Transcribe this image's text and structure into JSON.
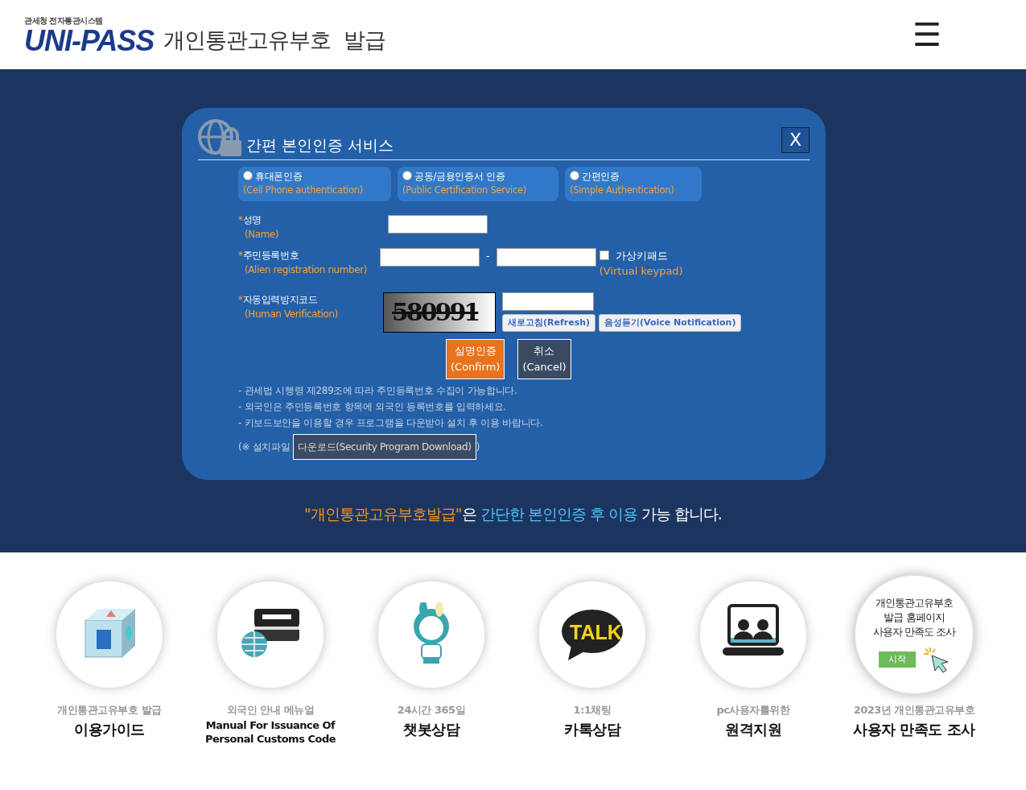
{
  "header": {
    "logo_caption": "관세청 전자통관시스템",
    "logo_text": "UNI-PASS",
    "title": "개인통관고유부호  발급",
    "menu_icon": "☰"
  },
  "modal": {
    "title": "간편 본인인증 서비스",
    "close": "X",
    "methods": [
      {
        "label": "휴대폰인증",
        "sublabel": "(Cell Phone authentication)",
        "selected": false
      },
      {
        "label": "공동/금융인증서 인증",
        "sublabel": "(Public Certification Service)",
        "selected": false
      },
      {
        "label": "간편인증",
        "sublabel": "(Simple Authentication)",
        "selected": false
      }
    ],
    "name": {
      "required": "*",
      "label": "성명",
      "sublabel": "(Name)"
    },
    "id_number": {
      "required": "*",
      "label": "주민등록번호",
      "sublabel": "(Alien registration number)",
      "separator": "-",
      "keypad": {
        "label": "가상키패드",
        "sublabel": "(Virtual keypad)",
        "checked": false
      }
    },
    "captcha": {
      "required": "*",
      "label": "자동입력방지코드",
      "sublabel": "(Human Verification)",
      "code": "580991",
      "refresh": "새로고침(Refresh)",
      "voice": "음성듣기(Voice Notification)"
    },
    "buttons": [
      {
        "kind": "confirm",
        "label": "실명인증",
        "sublabel": "(Confirm)"
      },
      {
        "kind": "cancel",
        "label": "취소",
        "sublabel": "(Cancel)"
      }
    ],
    "notes": [
      "- 관세법 시행령 제289조에 따라 주민등록번호 수집이 가능합니다.",
      "- 외국인은 주민등록번호 항목에 외국인 등록번호를 입력하세요.",
      "- 키보드보안을 이용할 경우 프로그램을 다운받아 설치 후 이용 바랍니다."
    ],
    "download": {
      "prefix": "(※ 설치파일",
      "link": "다운로드(Security Program Download)",
      "suffix": ")"
    }
  },
  "headline": [
    {
      "text": "\"개인통관고유부호발급\"",
      "color": "#f7931e"
    },
    {
      "text": "은 ",
      "color": "#ffffff"
    },
    {
      "text": "간단한 본인인증 후 이용",
      "color": "#4fc3f7"
    },
    {
      "text": " 가능 합니다.",
      "color": "#ffffff"
    }
  ],
  "shortcuts": [
    {
      "kind": "faq",
      "caption": "개인통관고유부호 발급",
      "title": "이용가이드"
    },
    {
      "kind": "manual",
      "caption": "외국인 안내 메뉴얼",
      "title": "Manual For Issuance Of Personal Customs Code"
    },
    {
      "kind": "chatbot",
      "caption": "24시간 365일",
      "title": "챗봇상담"
    },
    {
      "kind": "talk",
      "caption": "1:1채팅",
      "title": "카톡상담",
      "badge": "TALK"
    },
    {
      "kind": "remote",
      "caption": "pc사용자를위한",
      "title": "원격지원"
    },
    {
      "kind": "survey",
      "caption": "2023년 개인통관고유부호",
      "title": "사용자 만족도 조사",
      "lines": [
        "개인통관고유부호",
        "발급 홈페이지",
        "사용자 만족도 조사"
      ],
      "start": "시작"
    }
  ]
}
